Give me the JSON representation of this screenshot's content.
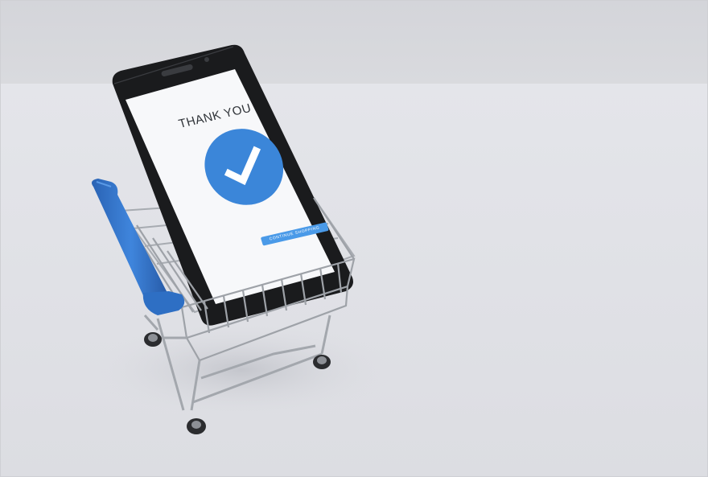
{
  "screen": {
    "heading": "THANK YOU",
    "button_label": "CONTINUE SHOPPING",
    "icon": "checkmark-circle-icon"
  },
  "colors": {
    "wall": "#d6d7dc",
    "floor": "#e2e3e8",
    "phone_body": "#1a1b1d",
    "screen_bg": "#f7f8fa",
    "accent_blue": "#3b86d9",
    "cart_handle": "#2e6fc4",
    "cart_wire": "#9ea2a8"
  }
}
